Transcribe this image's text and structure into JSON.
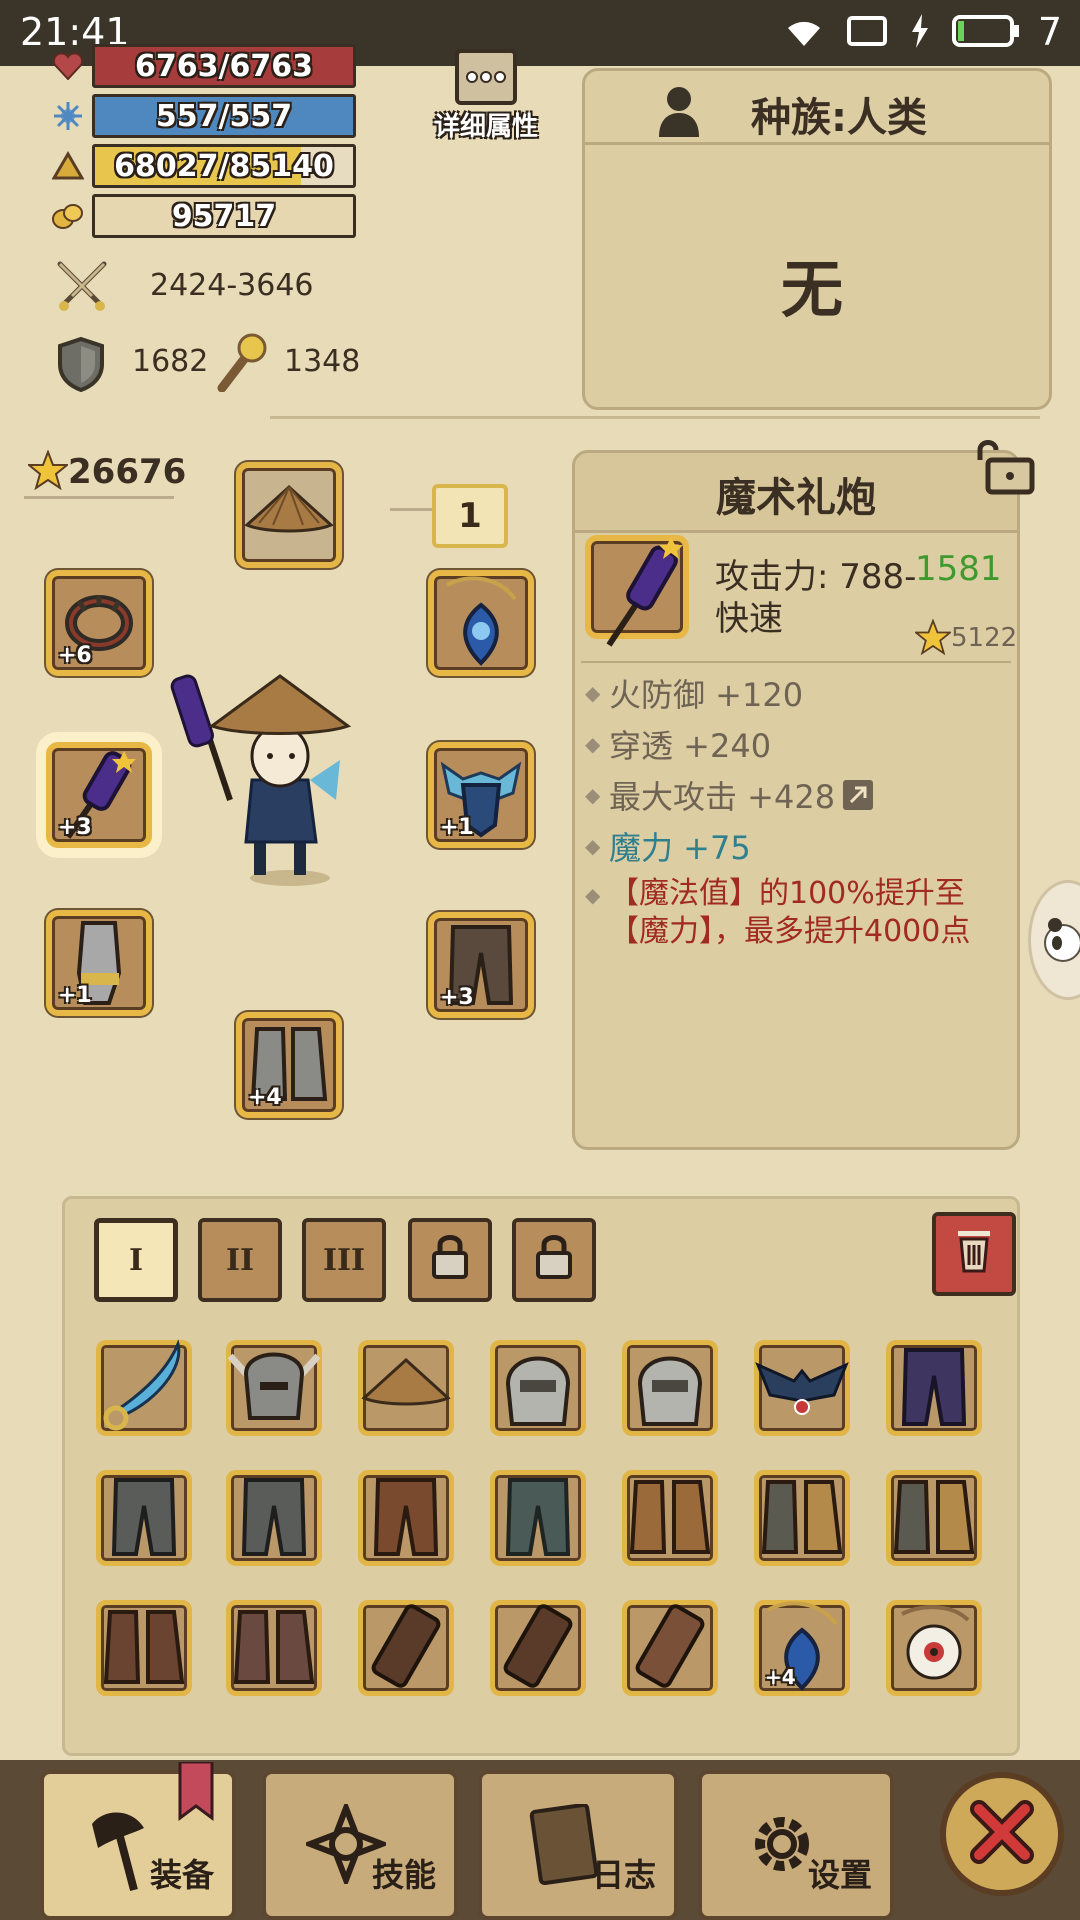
{
  "status_bar": {
    "time": "21:41",
    "battery": "7"
  },
  "stats": {
    "hp": {
      "text": "6763/6763",
      "fraction": 1.0,
      "color": "#a73c3c"
    },
    "mp": {
      "text": "557/557",
      "fraction": 1.0,
      "color": "#4f88be"
    },
    "exp": {
      "text": "68027/85140",
      "fraction": 0.799,
      "color": "#e8c54c"
    },
    "gold": {
      "text": "95717"
    },
    "attack": "2424-3646",
    "defense": "1682",
    "magic_resist": "1348"
  },
  "detail_button": {
    "label": "详细属性"
  },
  "race_panel": {
    "title": "种族:人类",
    "value": "无"
  },
  "score": "26676",
  "slot_number_badge": "1",
  "item_panel": {
    "name": "魔术礼炮",
    "attack_label": "攻击力: 788-",
    "attack_high": "1581",
    "speed": "快速",
    "star_score": "5122",
    "attrs": [
      {
        "text": "火防御 +120",
        "color": "#6f6454"
      },
      {
        "text": "穿透 +240",
        "color": "#6f6454"
      },
      {
        "text": "最大攻击 +428",
        "color": "#6f6454"
      },
      {
        "text": "魔力 +75",
        "color": "#2f7f8e"
      }
    ],
    "special_effect": "【魔法值】的100%提升至【魔力】，最多提升4000点"
  },
  "equipped": {
    "ring_plus": "+6",
    "weapon_plus": "+3",
    "gloves_plus": "+1",
    "boots_plus": "+4",
    "armor_plus": "+1",
    "pants_plus": "+3"
  },
  "tabs": [
    "I",
    "II",
    "III"
  ],
  "inventory_plus": "+4",
  "nav": {
    "equip": "装备",
    "skills": "技能",
    "log": "日志",
    "settings": "设置"
  }
}
